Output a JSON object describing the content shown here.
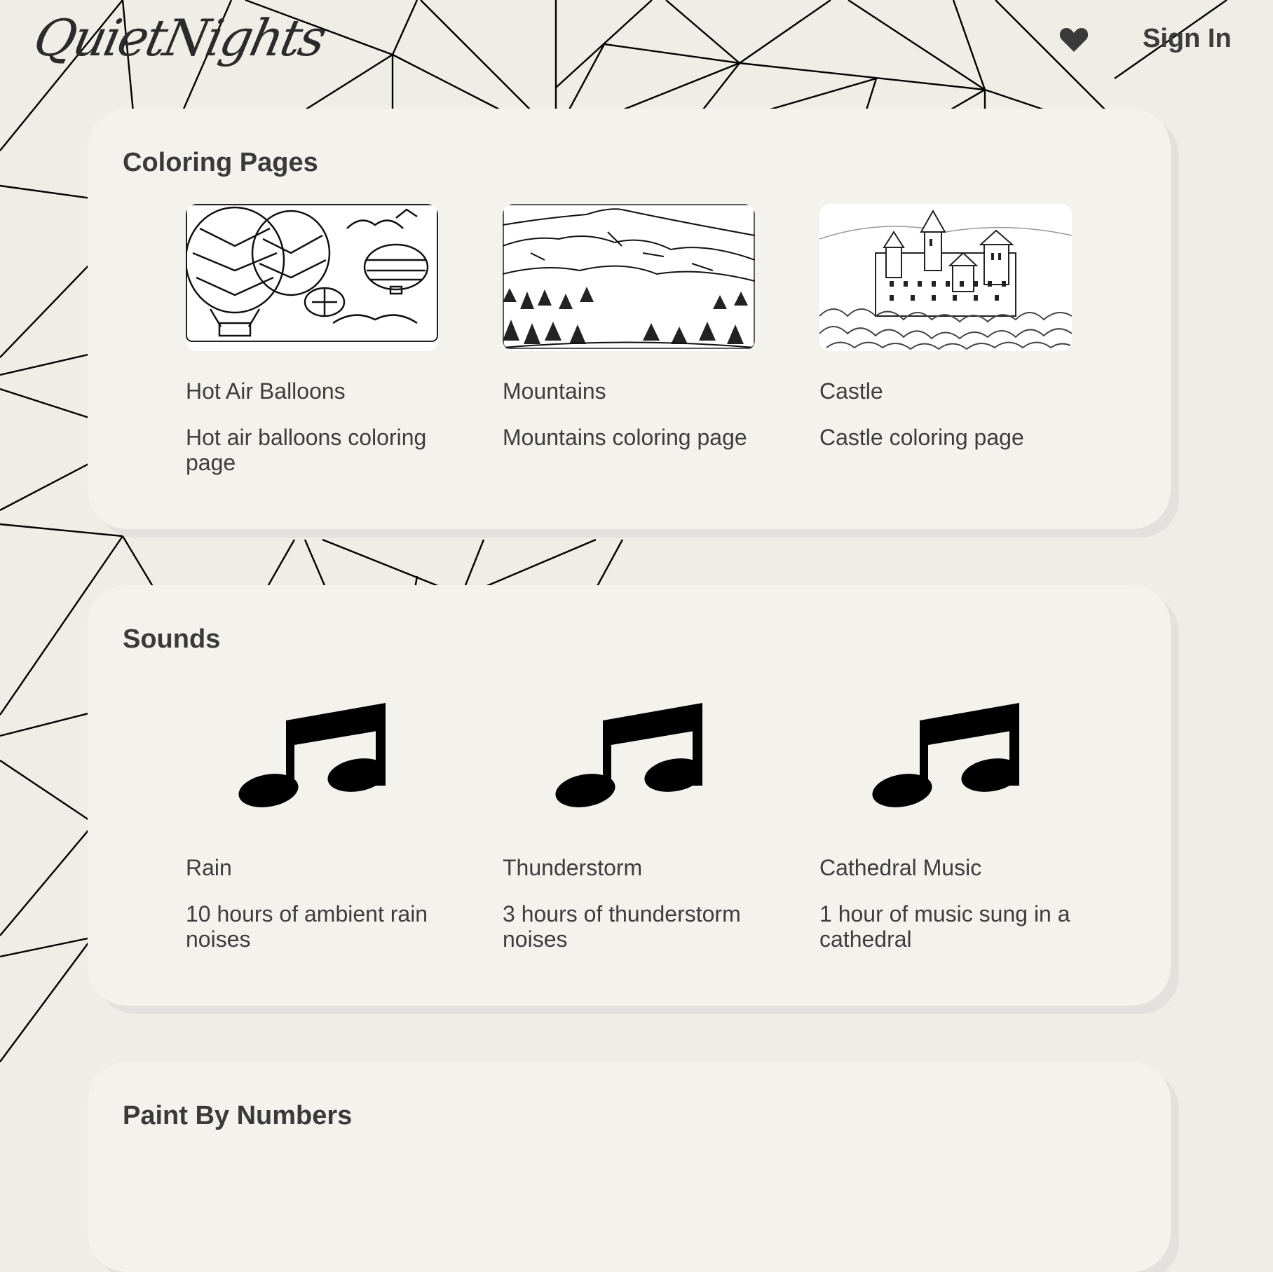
{
  "header": {
    "logo_text": "QuietNights",
    "favorites_icon": "heart-icon",
    "signin_label": "Sign In"
  },
  "sections": [
    {
      "title": "Coloring Pages",
      "items": [
        {
          "title": "Hot Air Balloons",
          "description": "Hot air balloons coloring page",
          "image": "hot-air-balloons-drawing"
        },
        {
          "title": "Mountains",
          "description": "Mountains coloring page",
          "image": "mountains-drawing"
        },
        {
          "title": "Castle",
          "description": "Castle coloring page",
          "image": "castle-drawing"
        }
      ]
    },
    {
      "title": "Sounds",
      "items": [
        {
          "title": "Rain",
          "description": "10 hours of ambient rain noises",
          "icon": "music-note-icon"
        },
        {
          "title": "Thunderstorm",
          "description": "3 hours of thunderstorm noises",
          "icon": "music-note-icon"
        },
        {
          "title": "Cathedral Music",
          "description": "1 hour of music sung in a cathedral",
          "icon": "music-note-icon"
        }
      ]
    },
    {
      "title": "Paint By Numbers",
      "items": []
    }
  ],
  "colors": {
    "background": "#eeede6",
    "card": "#f3f2ed",
    "card_shadow": "#e2e1de",
    "text": "#3a3a3a",
    "lines": "#000000"
  }
}
